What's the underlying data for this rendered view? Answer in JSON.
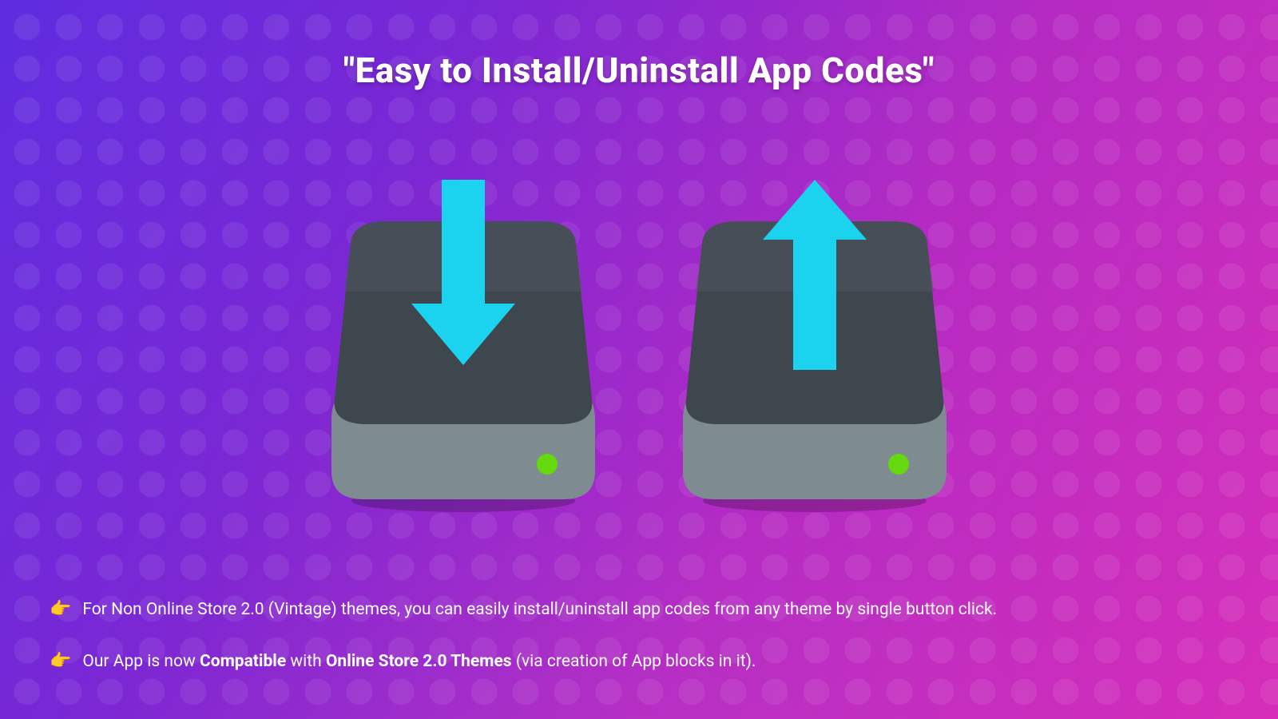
{
  "title": "\"Easy to Install/Uninstall App Codes\"",
  "icons": {
    "install": {
      "name": "drive-install-icon",
      "arrow": "down",
      "arrow_color": "#1bd3ef",
      "body_color": "#7e8c92",
      "top_color": "#3e474e",
      "top_hl": "#4c565e",
      "led": "#63d90e"
    },
    "uninstall": {
      "name": "drive-uninstall-icon",
      "arrow": "up",
      "arrow_color": "#1bd3ef",
      "body_color": "#7e8c92",
      "top_color": "#3e474e",
      "top_hl": "#4c565e",
      "led": "#63d90e"
    }
  },
  "bullets": [
    {
      "hand": "👉",
      "text": "For Non Online Store 2.0 (Vintage) themes, you can easily install/uninstall app codes from any theme by single button click."
    },
    {
      "hand": "👉",
      "html": "Our App is now <b>Compatible</b> with <b>Online Store 2.0 Themes</b> (via creation of App blocks in it)."
    }
  ]
}
